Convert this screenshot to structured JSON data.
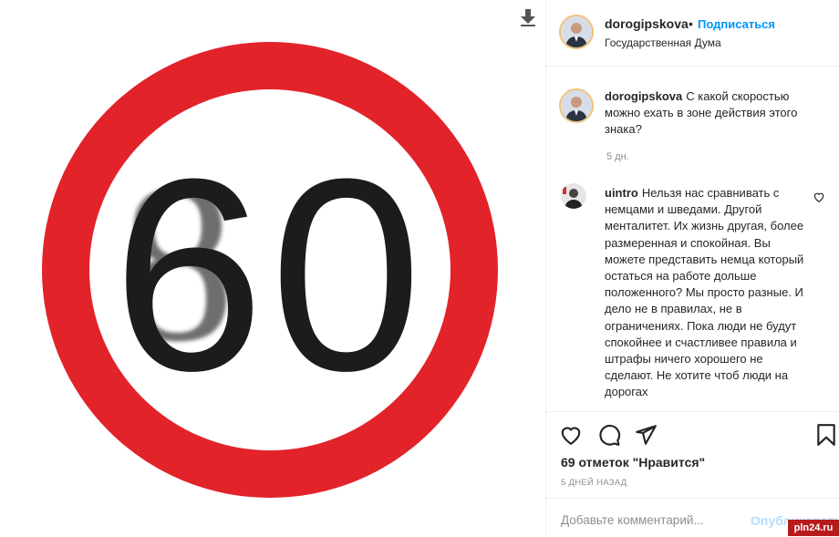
{
  "post": {
    "image": {
      "sign_digits": "60",
      "overwritten_digit": "8"
    },
    "header": {
      "username": "dorogipskova",
      "separator": "•",
      "follow_label": "Подписаться",
      "location": "Государственная Дума"
    },
    "caption": {
      "username": "dorogipskova",
      "text": "С какой скоростью можно ехать в зоне действия этого знака?",
      "time": "5 дн."
    },
    "comments": [
      {
        "username": "uintro",
        "text": "Нельзя нас сравнивать с немцами и шведами. Другой менталитет. Их жизнь другая, более размеренная и спокойная. Вы можете представить немца который остаться на работе дольше положенного? Мы просто разные. И дело не в правилах, не в ограничениях. Пока люди не будут спокойнее и счастливее правила и штрафы ничего хорошего не сделают. Не хотите чтоб люди на дорогах"
      }
    ],
    "likes": "69 отметок \"Нравится\"",
    "date": "5 ДНЕЙ НАЗАД",
    "add_comment_placeholder": "Добавьте комментарий...",
    "publish_label": "Опубликовать"
  },
  "watermark": "pln24.ru",
  "colors": {
    "sign_red": "#e2232a",
    "link_blue": "#0095f6",
    "muted": "#8e8e8e"
  }
}
